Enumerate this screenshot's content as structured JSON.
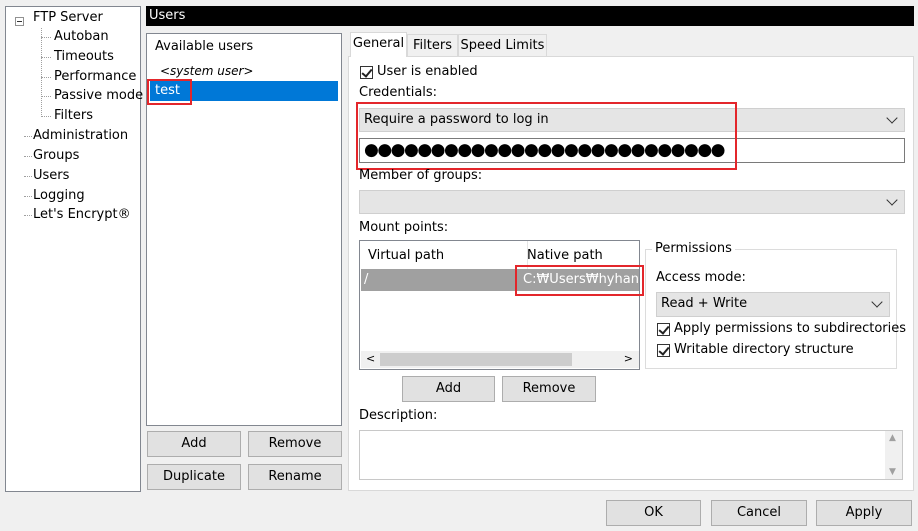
{
  "tree": {
    "root": "FTP Server",
    "children": [
      "Autoban",
      "Timeouts",
      "Performance",
      "Passive mode",
      "Filters"
    ],
    "items": [
      "Administration",
      "Groups",
      "Users",
      "Logging",
      "Let's Encrypt®"
    ]
  },
  "header": {
    "title": "Users"
  },
  "users": {
    "list_header": "Available users",
    "system_user": "<system user>",
    "selected_user": "test",
    "add": "Add",
    "remove": "Remove",
    "duplicate": "Duplicate",
    "rename": "Rename"
  },
  "tabs": [
    "General",
    "Filters",
    "Speed Limits"
  ],
  "general": {
    "user_enabled": "User is enabled",
    "credentials_label": "Credentials:",
    "credentials_value": "Require a password to log in",
    "password_dots": "●●●●●●●●●●●●●●●●●●●●●●●●●●●",
    "member_of_groups": "Member of groups:",
    "mount_points": "Mount points:",
    "mount_columns": [
      "Virtual path",
      "Native path"
    ],
    "mount_rows": [
      {
        "virtual": "/",
        "native": "C:₩Users₩hyhan₩D"
      }
    ],
    "mount_add": "Add",
    "mount_remove": "Remove",
    "description": "Description:"
  },
  "permissions": {
    "group_title": "Permissions",
    "access_mode_label": "Access mode:",
    "access_mode_value": "Read + Write",
    "apply_subdirs": "Apply permissions to subdirectories",
    "writable_dirs": "Writable directory structure"
  },
  "footer": {
    "ok": "OK",
    "cancel": "Cancel",
    "apply": "Apply"
  },
  "colors": {
    "selection": "#0078d7",
    "highlight_box": "#e3262b",
    "row_selected_gray": "#a0a0a0"
  }
}
